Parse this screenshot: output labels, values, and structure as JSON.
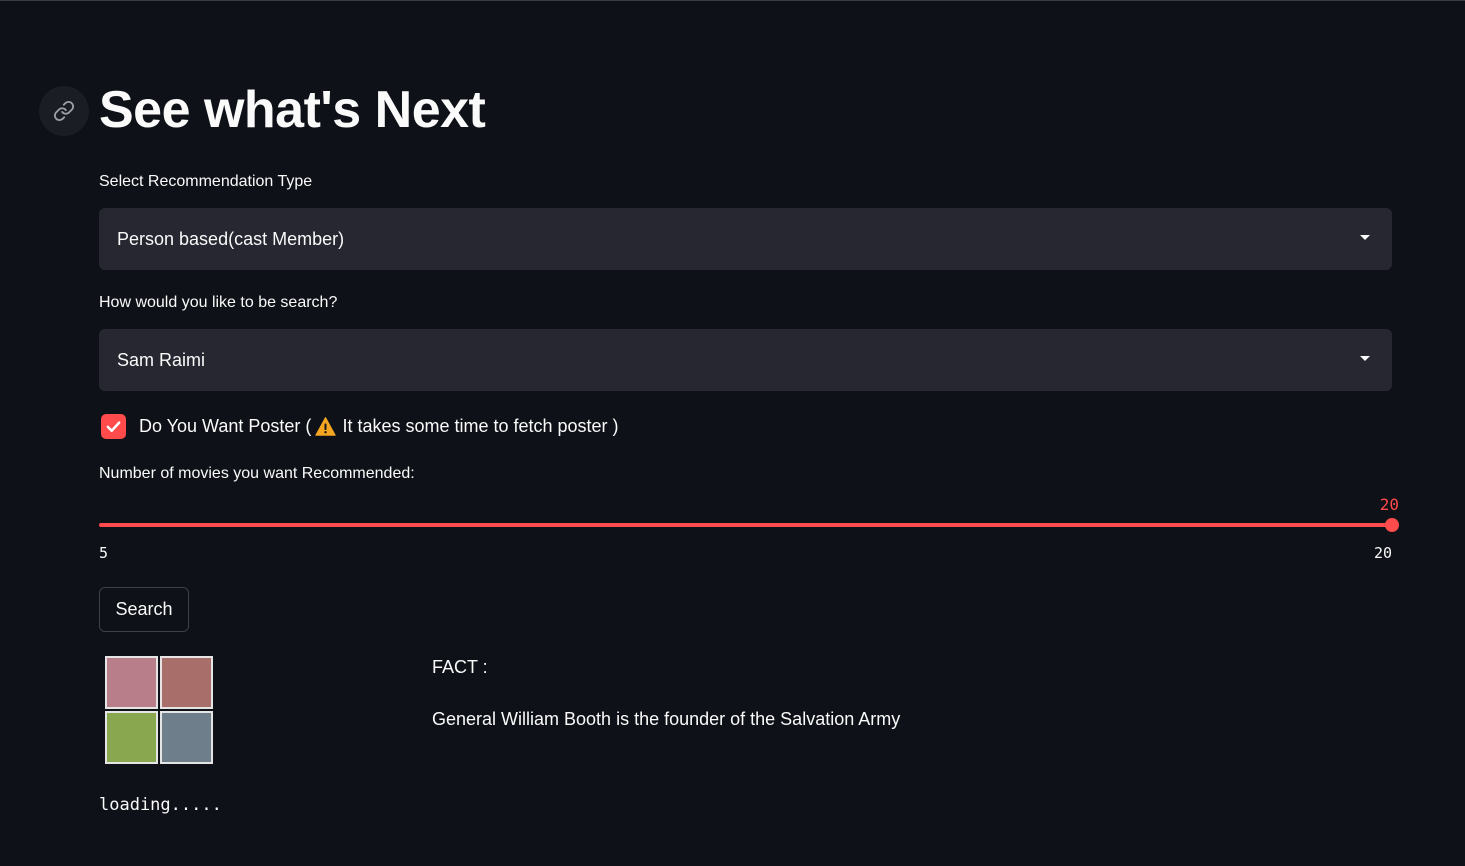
{
  "page": {
    "title": "See what's Next",
    "anchor_icon": "link-icon"
  },
  "recommendation_type": {
    "label": "Select Recommendation Type",
    "selected": "Person based(cast Member)"
  },
  "search_by": {
    "label": "How would you like to be search?",
    "selected": "Sam Raimi"
  },
  "poster_option": {
    "checked": true,
    "label_start": "Do You Want Poster (",
    "warning_icon": "warning-icon",
    "label_end": "It takes some time to fetch poster )"
  },
  "movie_count": {
    "label": "Number of movies you want Recommended:",
    "value": "20",
    "min": "5",
    "max": "20",
    "fraction": 1.0
  },
  "search_button": {
    "label": "Search"
  },
  "loading_image": {
    "colors": [
      "#b87f8a",
      "#a86e69",
      "#88a74f",
      "#6f7e8b"
    ]
  },
  "fact": {
    "heading": "FACT :",
    "text": "General William Booth is the founder of the Salvation Army"
  },
  "status": {
    "loading": "loading....."
  },
  "colors": {
    "background": "#0e1117",
    "input_bg": "#262730",
    "accent": "#ff4b4b",
    "text": "#fafafa"
  }
}
